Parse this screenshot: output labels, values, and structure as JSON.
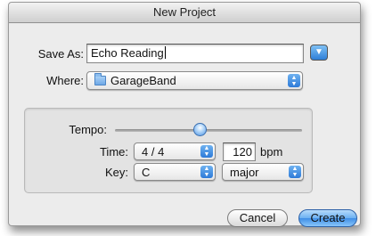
{
  "window": {
    "title": "New Project"
  },
  "save_as": {
    "label": "Save As:",
    "value": "Echo Reading"
  },
  "disclosure": {
    "icon": "triangle-down-icon"
  },
  "where": {
    "label": "Where:",
    "selected": "GarageBand",
    "icon": "folder-icon"
  },
  "tempo": {
    "label": "Tempo:",
    "level": 0.45
  },
  "time": {
    "label": "Time:",
    "selected": "4 / 4",
    "bpm_value": "120",
    "bpm_unit": "bpm"
  },
  "key": {
    "label": "Key:",
    "note": "C",
    "mode": "major"
  },
  "buttons": {
    "cancel": "Cancel",
    "create": "Create"
  },
  "colors": {
    "accent": "#3f8ee6",
    "window_bg": "#ececec"
  }
}
